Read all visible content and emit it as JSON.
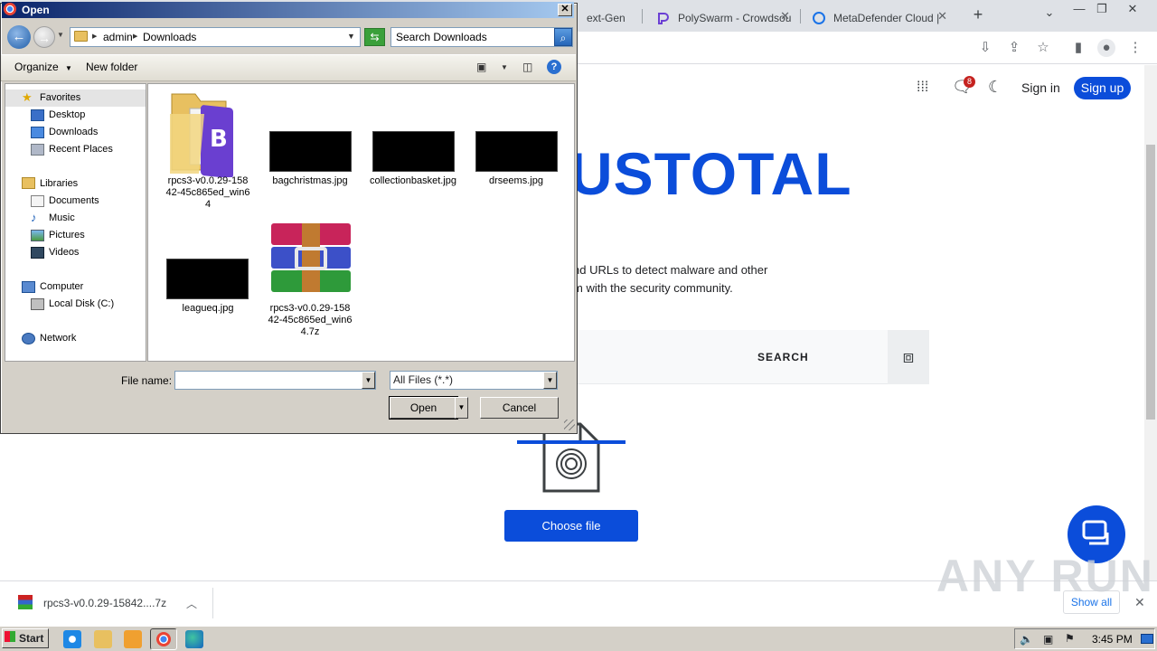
{
  "browser": {
    "tabs": [
      {
        "label": "ext-Gen",
        "left": 0
      },
      {
        "label": "PolySwarm - Crowdsou"
      },
      {
        "label": "MetaDefender Cloud |"
      }
    ],
    "new_tab": "+",
    "tab_list": "⌄",
    "window_controls": [
      "—",
      "❐",
      "✕"
    ]
  },
  "virustotal": {
    "notifications_count": "8",
    "sign_in": "Sign in",
    "sign_up": "Sign up",
    "logo_text": "USTOTAL",
    "desc_line1": "nd URLs to detect malware and other",
    "desc_line2": "m with the security community.",
    "search_button": "SEARCH",
    "choose_file": "Choose file"
  },
  "download_bar": {
    "filename": "rpcs3-v0.0.29-15842....7z",
    "show_all": "Show all"
  },
  "watermark": "ANY RUN",
  "taskbar": {
    "start": "Start",
    "clock": "3:45 PM"
  },
  "dialog": {
    "title": "Open",
    "breadcrumb": [
      "admin",
      "Downloads"
    ],
    "search_placeholder": "Search Downloads",
    "organize": "Organize",
    "new_folder": "New folder",
    "nav": {
      "favorites": "Favorites",
      "desktop": "Desktop",
      "downloads": "Downloads",
      "recent": "Recent Places",
      "libraries": "Libraries",
      "documents": "Documents",
      "music": "Music",
      "pictures": "Pictures",
      "videos": "Videos",
      "computer": "Computer",
      "local_disk": "Local Disk (C:)",
      "network": "Network"
    },
    "files": [
      {
        "name": "rpcs3-v0.0.29-15842-45c865ed_win64",
        "line1": "rpcs3-v0.0.29-158",
        "line2": "42-45c865ed_win6",
        "line3": "4"
      },
      {
        "name": "bagchristmas.jpg"
      },
      {
        "name": "collectionbasket.jpg"
      },
      {
        "name": "drseems.jpg"
      },
      {
        "name": "leagueq.jpg"
      },
      {
        "name": "rpcs3-v0.0.29-15842-45c865ed_win64.7z",
        "line1": "rpcs3-v0.0.29-158",
        "line2": "42-45c865ed_win6",
        "line3": "4.7z"
      }
    ],
    "file_name_label": "File name:",
    "file_name_value": "",
    "file_type": "All Files (*.*)",
    "open_button": "Open",
    "cancel_button": "Cancel"
  },
  "colors": {
    "vt_blue": "#0b4dda",
    "title_bar": "#0a246a",
    "dialog_face": "#d4d0c8"
  }
}
